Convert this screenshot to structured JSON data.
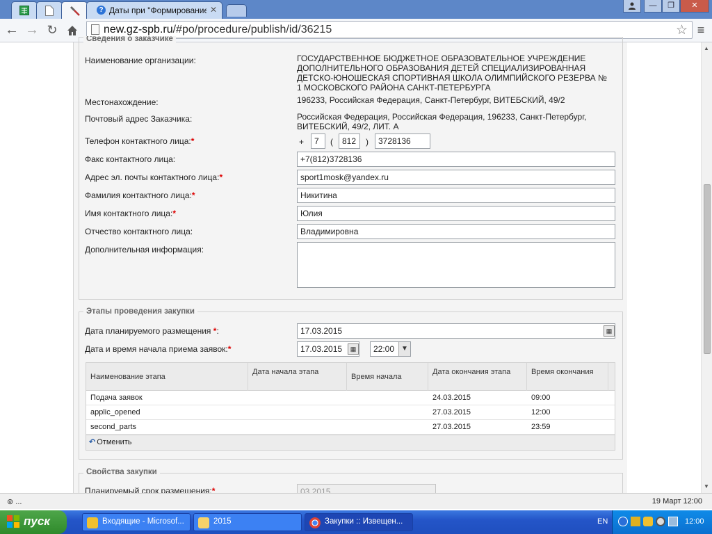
{
  "tabs": [
    {
      "title": ""
    },
    {
      "title": ""
    },
    {
      "title": ""
    },
    {
      "title": "Даты при \"Формирование и"
    }
  ],
  "window_controls": {
    "minimize": "—",
    "maximize": "❐",
    "close": "✕"
  },
  "address_bar": {
    "domain": "new.gz-spb.ru",
    "path": "/#po/procedure/publish/id/36215"
  },
  "customer_section": {
    "legend": "Сведения о заказчике",
    "org_name_label": "Наименование организации:",
    "org_name_value": "ГОСУДАРСТВЕННОЕ БЮДЖЕТНОЕ ОБРАЗОВАТЕЛЬНОЕ УЧРЕЖДЕНИЕ ДОПОЛНИТЕЛЬНОГО ОБРАЗОВАНИЯ ДЕТЕЙ СПЕЦИАЛИЗИРОВАННАЯ ДЕТСКО-ЮНОШЕСКАЯ СПОРТИВНАЯ ШКОЛА ОЛИМПИЙСКОГО РЕЗЕРВА № 1 МОСКОВСКОГО РАЙОНА САНКТ-ПЕТЕРБУРГА",
    "location_label": "Местонахождение:",
    "location_value": "196233, Российская Федерация, Санкт-Петербург, ВИТЕБСКИЙ, 49/2",
    "postal_label": "Почтовый адрес Заказчика:",
    "postal_value": "Российская Федерация, Российская Федерация, 196233, Санкт-Петербург, ВИТЕБСКИЙ, 49/2, ЛИТ. А",
    "phone_label": "Телефон контактного лица:",
    "phone_plus": "+",
    "phone_country": "7",
    "phone_open": "(",
    "phone_area": "812",
    "phone_close": ")",
    "phone_number": "3728136",
    "fax_label": "Факс контактного лица:",
    "fax_value": "+7(812)3728136",
    "email_label": "Адрес эл. почты контактного лица:",
    "email_value": "sport1mosk@yandex.ru",
    "lastname_label": "Фамилия контактного лица:",
    "lastname_value": "Никитина",
    "firstname_label": "Имя контактного лица:",
    "firstname_value": "Юлия",
    "patronymic_label": "Отчество контактного лица:",
    "patronymic_value": "Владимировна",
    "extra_label": "Дополнительная информация:",
    "extra_value": "",
    "required_mark": "*"
  },
  "stages_section": {
    "legend": "Этапы проведения закупки",
    "planned_date_label": "Дата планируемого размещения",
    "planned_date_suffix": ":",
    "planned_date_value": "17.03.2015",
    "start_datetime_label": "Дата и время начала приема заявок:",
    "start_date_value": "17.03.2015",
    "start_time_value": "22:00",
    "table": {
      "columns": [
        "Наименование этапа",
        "Дата начала этапа",
        "Время начала",
        "Дата окончания этапа",
        "Время окончания"
      ],
      "rows": [
        [
          "Подача заявок",
          "",
          "",
          "24.03.2015",
          "09:00"
        ],
        [
          "applic_opened",
          "",
          "",
          "27.03.2015",
          "12:00"
        ],
        [
          "second_parts",
          "",
          "",
          "27.03.2015",
          "23:59"
        ]
      ]
    },
    "undo_label": "Отменить"
  },
  "props_section": {
    "legend": "Свойства закупки",
    "planned_term_label": "Планируемый срок размещения:",
    "planned_term_value": "03.2015"
  },
  "status_bar": {
    "left": "⊚ ...",
    "right": "19 Март 12:00"
  },
  "taskbar": {
    "start_label": "пуск",
    "items": [
      {
        "label": "Входящие - Microsof..."
      },
      {
        "label": "2015"
      },
      {
        "label": "Закупки :: Извещен..."
      }
    ],
    "language": "EN",
    "clock": "12:00"
  }
}
